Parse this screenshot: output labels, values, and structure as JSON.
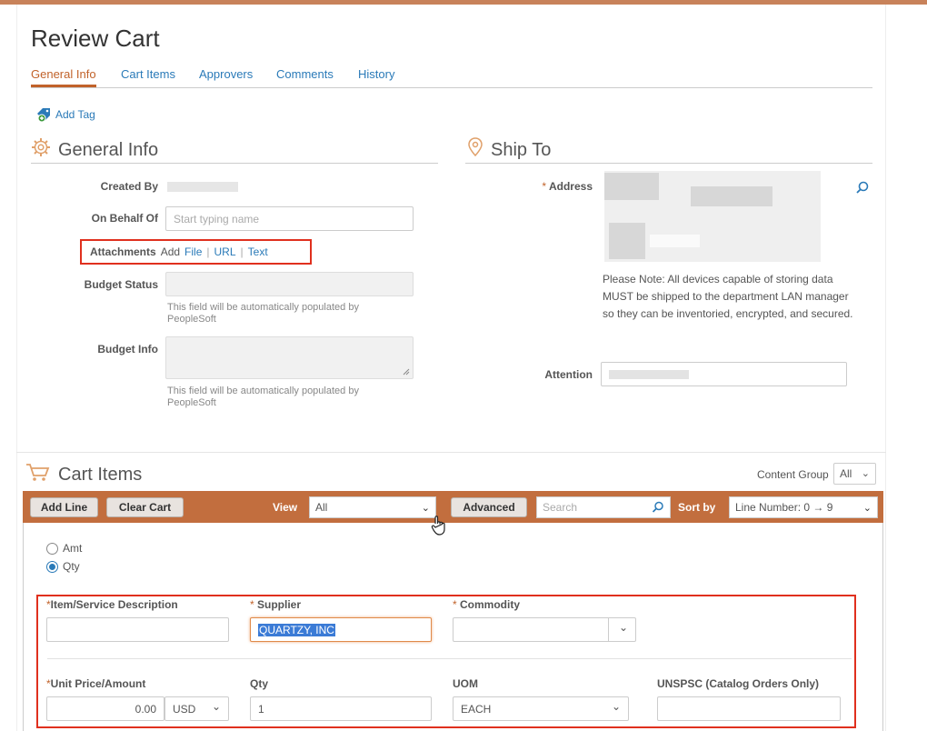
{
  "page": {
    "title": "Review Cart"
  },
  "tabs": [
    {
      "label": "General Info",
      "active": true
    },
    {
      "label": "Cart Items"
    },
    {
      "label": "Approvers"
    },
    {
      "label": "Comments"
    },
    {
      "label": "History"
    }
  ],
  "add_tag": {
    "label": "Add Tag"
  },
  "general_info": {
    "heading": "General Info",
    "created_by_label": "Created By",
    "on_behalf_of_label": "On Behalf Of",
    "on_behalf_of_placeholder": "Start typing name",
    "attachments_label": "Attachments",
    "attachments_add": "Add",
    "attachments_file": "File",
    "attachments_url": "URL",
    "attachments_text": "Text",
    "attachments_sep": "|",
    "budget_status_label": "Budget Status",
    "budget_status_help": "This field will be automatically populated by PeopleSoft",
    "budget_info_label": "Budget Info",
    "budget_info_help": "This field will be automatically populated by PeopleSoft"
  },
  "ship_to": {
    "heading": "Ship To",
    "address_label": "Address",
    "required_mark": "*",
    "note": "Please Note: All devices capable of storing data MUST be shipped to the department LAN manager so they can be inventoried, encrypted, and secured.",
    "attention_label": "Attention"
  },
  "cart_items": {
    "heading": "Cart Items",
    "content_group_label": "Content Group",
    "content_group_value": "All"
  },
  "toolbar": {
    "add_line": "Add Line",
    "clear_cart": "Clear Cart",
    "view_label": "View",
    "view_value": "All",
    "advanced": "Advanced",
    "search_placeholder": "Search",
    "sort_by_label": "Sort by",
    "sort_by_value": "Line Number: 0 → 9"
  },
  "line_form": {
    "radio_amt": "Amt",
    "radio_qty": "Qty",
    "radio_selected": "Qty",
    "item_desc_label": "Item/Service Description",
    "item_desc_value": "",
    "supplier_label": "Supplier",
    "supplier_value": "QUARTZY, INC",
    "commodity_label": "Commodity",
    "commodity_value": "",
    "unit_price_label": "Unit Price/Amount",
    "unit_price_value": "0.00",
    "currency_value": "USD",
    "qty_label": "Qty",
    "qty_value": "1",
    "uom_label": "UOM",
    "uom_value": "EACH",
    "unspsc_label": "UNSPSC (Catalog Orders Only)",
    "unspsc_value": ""
  },
  "colors": {
    "accent": "#c1622a",
    "link": "#2a7ab8",
    "toolbar": "#c26e3e",
    "highlight_box": "#e0301e"
  }
}
